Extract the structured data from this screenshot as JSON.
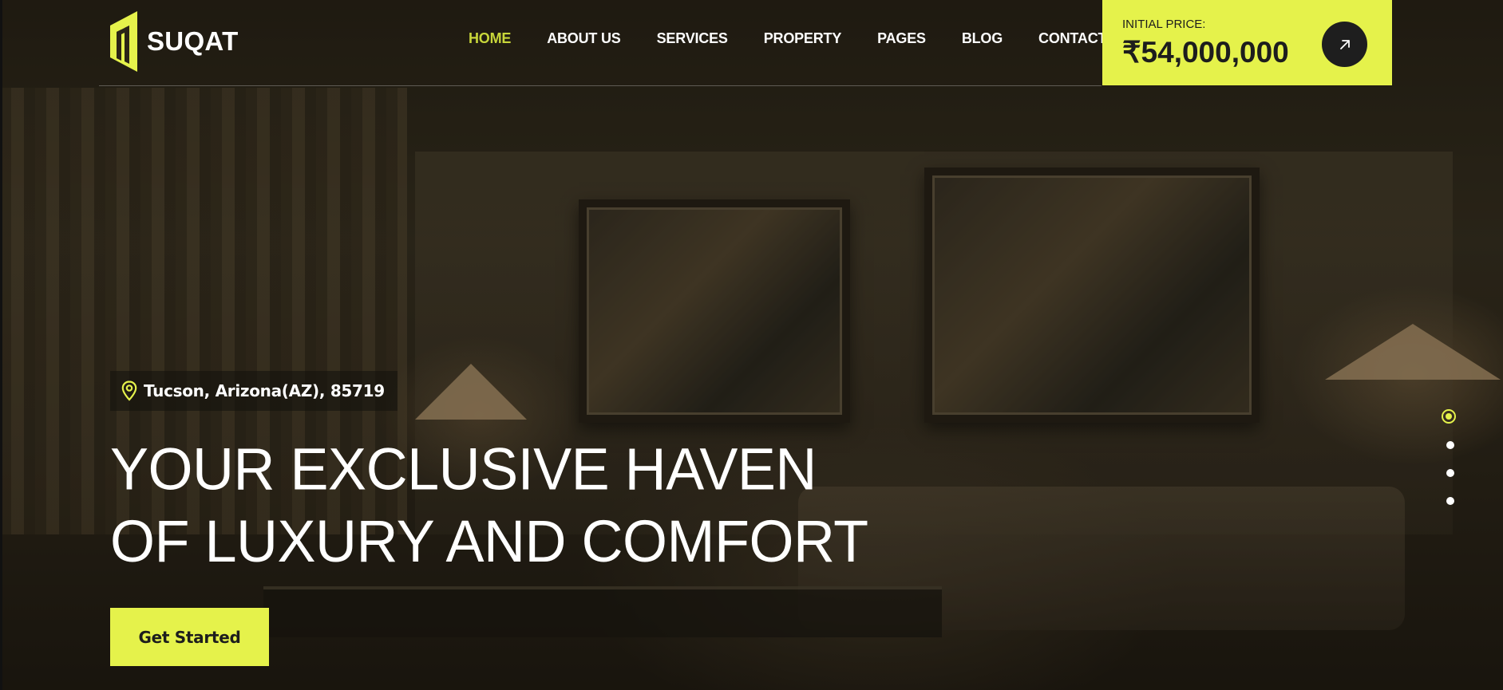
{
  "brand": {
    "name": "SUQAT",
    "accent_color": "#e5f24b"
  },
  "nav": {
    "items": [
      {
        "label": "HOME",
        "active": true
      },
      {
        "label": "ABOUT US",
        "active": false
      },
      {
        "label": "SERVICES",
        "active": false
      },
      {
        "label": "PROPERTY",
        "active": false
      },
      {
        "label": "PAGES",
        "active": false
      },
      {
        "label": "BLOG",
        "active": false
      },
      {
        "label": "CONTACT",
        "active": false
      }
    ]
  },
  "price": {
    "label": "INITIAL PRICE:",
    "value": "₹54,000,000",
    "button_icon": "arrow-up-right-icon"
  },
  "hero": {
    "location": "Tucson, Arizona(AZ), 85719",
    "location_icon": "map-pin-icon",
    "headline_line1": "YOUR EXCLUSIVE HAVEN",
    "headline_line2": "OF LUXURY AND COMFORT",
    "cta_label": "Get Started"
  },
  "slider": {
    "dot_count": 4,
    "active_index": 0
  }
}
